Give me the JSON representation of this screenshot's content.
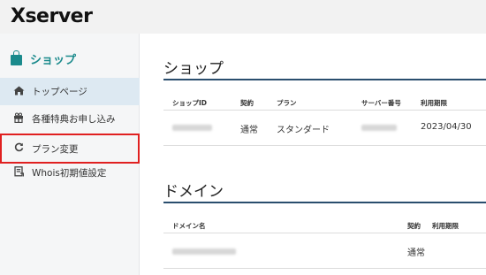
{
  "header": {
    "logo": "Xserver"
  },
  "sidebar": {
    "title": "ショップ",
    "items": [
      {
        "label": "トップページ",
        "icon": "home-icon"
      },
      {
        "label": "各種特典お申し込み",
        "icon": "gift-icon"
      },
      {
        "label": "プラン変更",
        "icon": "refresh-icon"
      },
      {
        "label": "Whois初期値設定",
        "icon": "document-icon"
      }
    ]
  },
  "shop": {
    "title": "ショップ",
    "columns": [
      "ショップID",
      "契約",
      "プラン",
      "サーバー番号",
      "利用期限"
    ],
    "row": {
      "contract": "通常",
      "plan": "スタンダード",
      "expiry": "2023/04/30"
    }
  },
  "domain": {
    "title": "ドメイン",
    "columns": [
      "ドメイン名",
      "契約",
      "利用期限"
    ],
    "row": {
      "contract": "通常"
    }
  },
  "colors": {
    "accent": "#1a8a8c",
    "rule": "#2a4e6e",
    "highlight": "#e02020",
    "active_bg": "#dde9f2"
  }
}
